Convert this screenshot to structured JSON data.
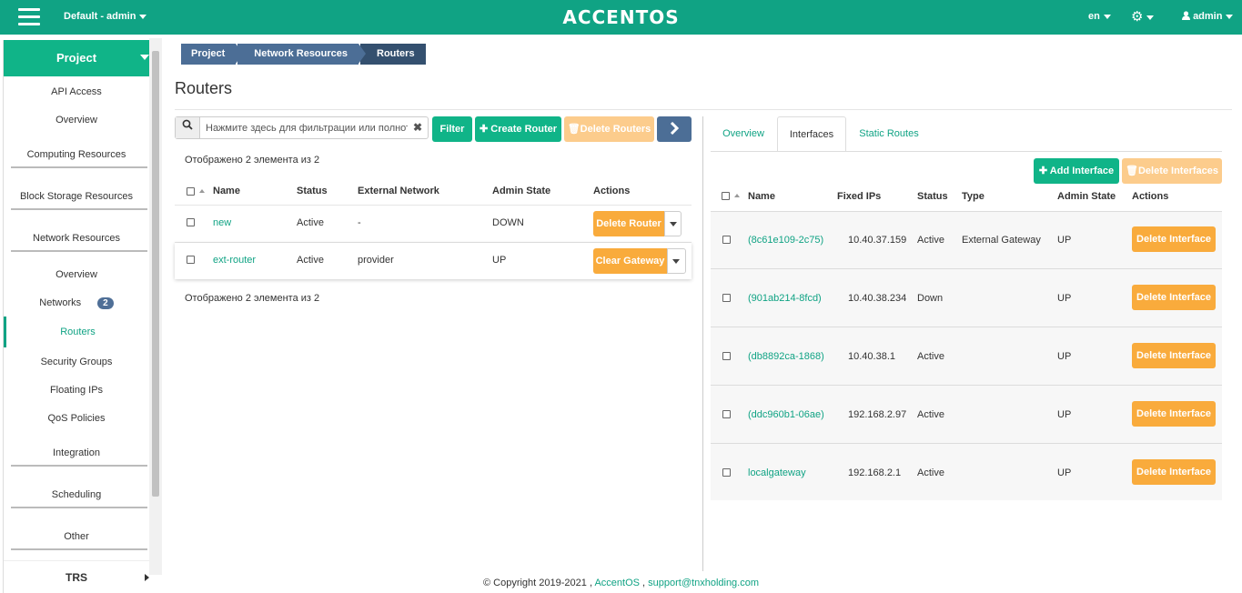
{
  "topbar": {
    "project_selector": "Default - admin",
    "logo": "ACCENTOS",
    "language": "en",
    "user": "admin",
    "icons": [
      "menu-icon",
      "gear-icon",
      "user-icon"
    ]
  },
  "sidebar": {
    "project": "Project",
    "items": [
      {
        "label": "API Access"
      },
      {
        "label": "Overview"
      },
      {
        "label": "Computing Resources"
      },
      {
        "label": "Block Storage Resources"
      },
      {
        "label": "Network Resources"
      },
      {
        "label": "Overview"
      },
      {
        "label": "Networks",
        "badge": "2"
      },
      {
        "label": "Routers",
        "active": true
      },
      {
        "label": "Security Groups"
      },
      {
        "label": "Floating IPs"
      },
      {
        "label": "QoS Policies"
      },
      {
        "label": "Integration"
      },
      {
        "label": "Scheduling"
      },
      {
        "label": "Other"
      }
    ],
    "trs": "TRS"
  },
  "breadcrumb": [
    "Project",
    "Network Resources",
    "Routers"
  ],
  "page_title": "Routers",
  "left": {
    "search_placeholder": "Нажмите здесь для фильтрации или полноте...",
    "filter": "Filter",
    "create_router": "Create Router",
    "delete_routers": "Delete Routers",
    "count_top": "Отображено 2 элемента из 2",
    "count_bottom": "Отображено 2 элемента из 2",
    "columns": [
      "Name",
      "Status",
      "External Network",
      "Admin State",
      "Actions"
    ],
    "rows": [
      {
        "name": "new",
        "status": "Active",
        "network": "-",
        "admin_state": "DOWN",
        "action": "Delete Router"
      },
      {
        "name": "ext-router",
        "status": "Active",
        "network": "provider",
        "admin_state": "UP",
        "action": "Clear Gateway"
      }
    ]
  },
  "right": {
    "tabs": [
      "Overview",
      "Interfaces",
      "Static Routes"
    ],
    "active_tab": "Interfaces",
    "add_interface": "Add Interface",
    "delete_interfaces": "Delete Interfaces",
    "columns": [
      "Name",
      "Fixed IPs",
      "Status",
      "Type",
      "Admin State",
      "Actions"
    ],
    "rows": [
      {
        "name": "(8c61e109-2c75)",
        "ip": "10.40.37.159",
        "status": "Active",
        "type": "External Gateway",
        "admin_state": "UP",
        "action": "Delete Interface"
      },
      {
        "name": "(901ab214-8fcd)",
        "ip": "10.40.38.234",
        "status": "Down",
        "type": "",
        "admin_state": "UP",
        "action": "Delete Interface"
      },
      {
        "name": "(db8892ca-1868)",
        "ip": "10.40.38.1",
        "status": "Active",
        "type": "",
        "admin_state": "UP",
        "action": "Delete Interface"
      },
      {
        "name": "(ddc960b1-06ae)",
        "ip": "192.168.2.97",
        "status": "Active",
        "type": "",
        "admin_state": "UP",
        "action": "Delete Interface"
      },
      {
        "name": "localgateway",
        "ip": "192.168.2.1",
        "status": "Active",
        "type": "",
        "admin_state": "UP",
        "action": "Delete Interface"
      }
    ]
  },
  "footer": {
    "copyright": "© Copyright 2019-2021 ,",
    "brand": "AccentOS",
    "sep": ",",
    "email": "support@tnxholding.com"
  },
  "colors": {
    "brand": "#10a384",
    "accent_orange": "#f9ab3c",
    "navy": "#4c6e96"
  }
}
